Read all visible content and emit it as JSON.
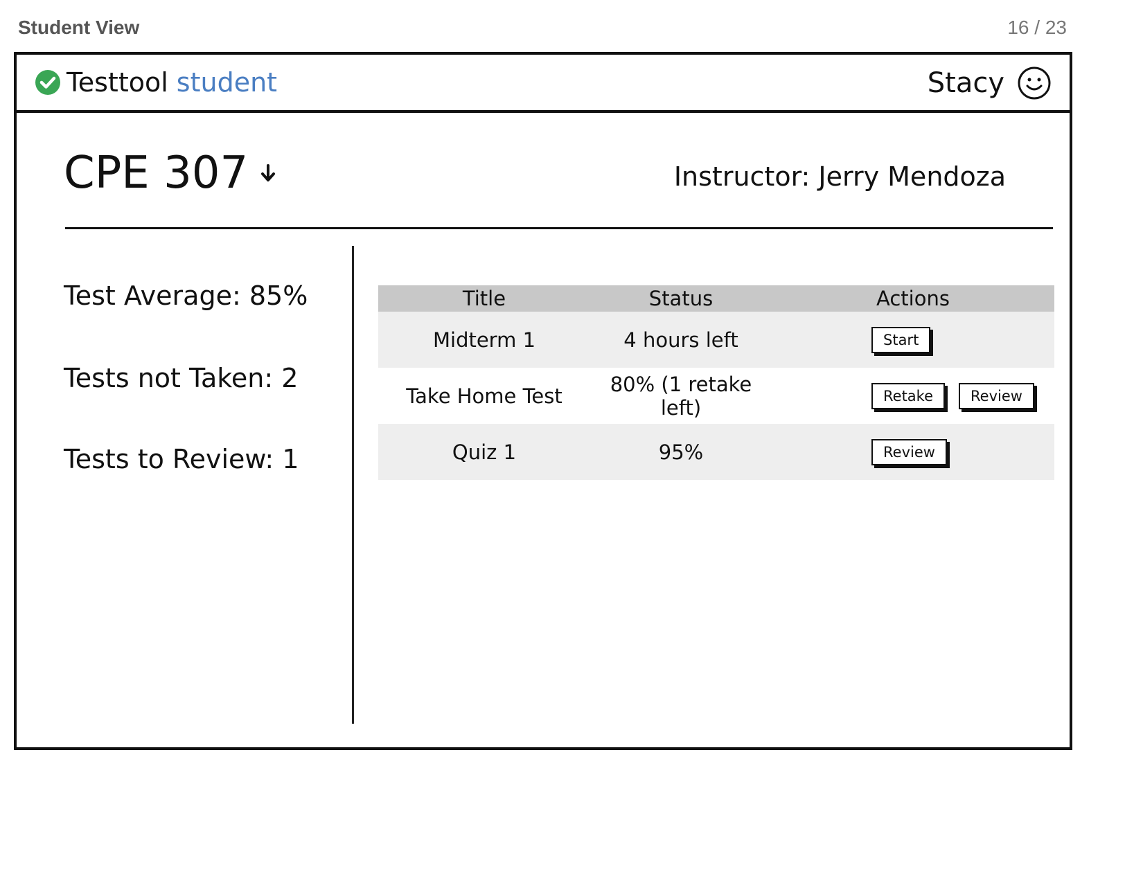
{
  "page": {
    "label": "Student View",
    "counter": "16 / 23"
  },
  "app": {
    "name": "Testtool",
    "mode": "student",
    "mode_color": "#4a7ec2",
    "logo_icon": "green-check-circle",
    "logo_color": "#3aa655"
  },
  "user": {
    "name": "Stacy",
    "avatar_icon": "smiley-face"
  },
  "course": {
    "code": "CPE 307",
    "dropdown_icon": "arrow-down",
    "instructor": "Instructor: Jerry Mendoza"
  },
  "stats": [
    {
      "label": "Test Average: 85%"
    },
    {
      "label": "Tests not Taken: 2"
    },
    {
      "label": "Tests to Review: 1"
    }
  ],
  "table": {
    "headers": [
      "Title",
      "Status",
      "Actions"
    ],
    "rows": [
      {
        "title": "Midterm 1",
        "status": "4 hours left",
        "actions": [
          "Start"
        ]
      },
      {
        "title": "Take Home Test",
        "status": "80% (1 retake left)",
        "actions": [
          "Retake",
          "Review"
        ]
      },
      {
        "title": "Quiz 1",
        "status": "95%",
        "actions": [
          "Review"
        ]
      }
    ]
  }
}
